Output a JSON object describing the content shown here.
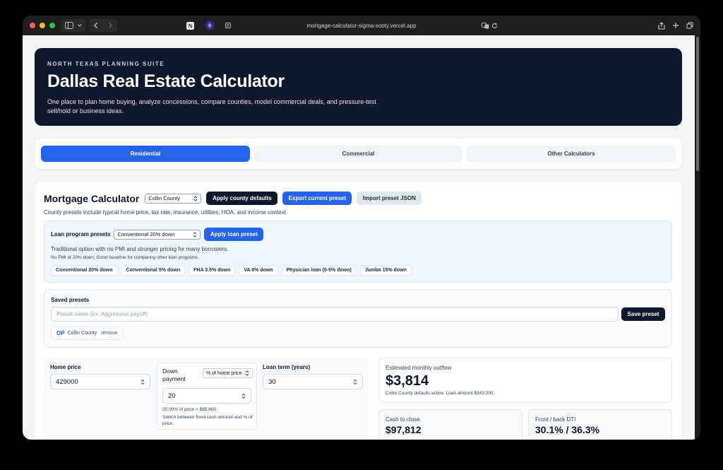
{
  "browser": {
    "url": "mortgage-calculator-sigma-sooty.vercel.app"
  },
  "hero": {
    "eyebrow": "NORTH TEXAS PLANNING SUITE",
    "title": "Dallas Real Estate Calculator",
    "description": "One place to plan home buying, analyze concessions, compare counties, model commercial deals, and pressure-test sell/hold or business ideas."
  },
  "tabs": [
    {
      "label": "Residential"
    },
    {
      "label": "Commercial"
    },
    {
      "label": "Other Calculators"
    }
  ],
  "mortgage": {
    "title": "Mortgage Calculator",
    "county_select": "Collin County",
    "apply_county_label": "Apply county defaults",
    "export_label": "Export current preset",
    "import_label": "Import preset JSON",
    "subtitle": "County presets include typical home price, tax rate, insurance, utilities, HOA, and income context."
  },
  "loan_programs": {
    "label": "Loan program presets",
    "select": "Conventional 20% down",
    "apply_label": "Apply loan preset",
    "description": "Traditional option with no PMI and stronger pricing for many borrowers.",
    "note": "No PMI at 20% down. Good baseline for comparing other loan programs.",
    "chips": [
      "Conventional 20% down",
      "Conventional 5% down",
      "FHA 3.5% down",
      "VA 0% down",
      "Physician loan (0-5% down)",
      "Jumbo 15% down"
    ]
  },
  "saved_presets": {
    "label": "Saved presets",
    "name_placeholder": "Preset name (ex: Aggressive payoff)",
    "save_label": "Save preset",
    "items": [
      {
        "initials": "OP",
        "county": "Collin County",
        "remove_label": "remove"
      }
    ]
  },
  "inputs": {
    "home_price_label": "Home price",
    "home_price_value": "429000",
    "down_payment_label": "Down payment",
    "down_payment_mode": "% of home price",
    "down_payment_value": "20",
    "down_payment_note": "20.00% of price = $85,800",
    "down_payment_hint": "Switch between fixed cash amount and % of price.",
    "loan_term_label": "Loan term (years)",
    "loan_term_value": "30"
  },
  "results": {
    "monthly_label": "Estimated monthly outflow",
    "monthly_value": "$3,814",
    "monthly_note": "Collin County defaults active. Loan amount $343,200.",
    "cash_label": "Cash to close",
    "cash_value": "$97,812",
    "dti_label": "Front / back DTI",
    "dti_value": "30.1% / 36.3%"
  },
  "colors": {
    "accent": "#2563eb",
    "hero_bg": "#0f172a"
  }
}
